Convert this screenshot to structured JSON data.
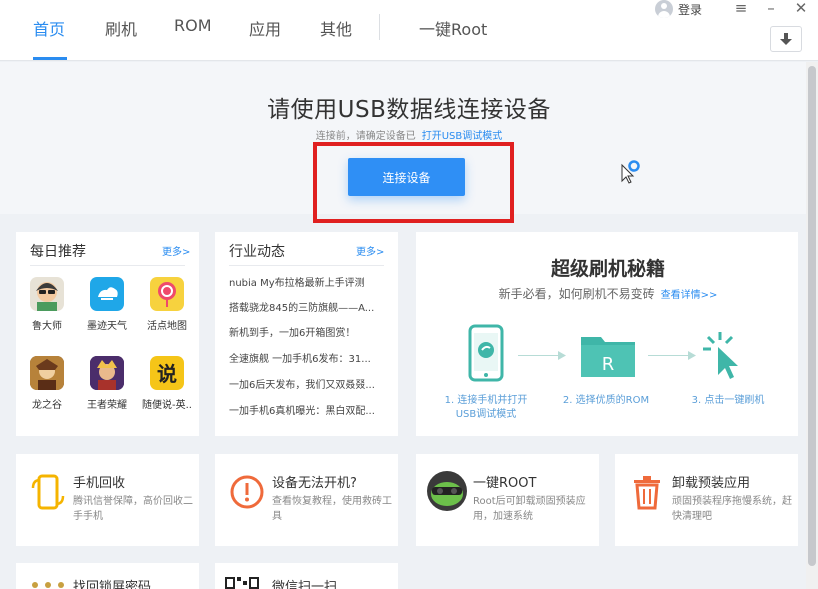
{
  "nav": {
    "tabs": [
      "首页",
      "刷机",
      "ROM",
      "应用",
      "其他",
      "一键Root"
    ],
    "login": "登录"
  },
  "hero": {
    "title": "请使用USB数据线连接设备",
    "subtitle": "连接前，请确定设备已",
    "subtitle_link": "打开USB调试模式",
    "button": "连接设备"
  },
  "daily": {
    "title": "每日推荐",
    "more": "更多>",
    "apps": [
      {
        "name": "鲁大师",
        "icon": "ludashi-icon"
      },
      {
        "name": "墨迹天气",
        "icon": "moji-weather-icon"
      },
      {
        "name": "活点地图",
        "icon": "map-pin-icon"
      },
      {
        "name": "龙之谷",
        "icon": "dragon-nest-icon"
      },
      {
        "name": "王者荣耀",
        "icon": "honor-of-kings-icon"
      },
      {
        "name": "随便说-英...",
        "icon": "shuo-icon"
      }
    ]
  },
  "news": {
    "title": "行业动态",
    "more": "更多>",
    "items": [
      "nubia My布拉格最新上手评测",
      "搭载骁龙845的三防旗舰——A...",
      "新机到手，一加6开箱图赏！",
      "全速旗舰 一加手机6发布：31...",
      "一加6后天发布，我们又双叒叕...",
      "一加手机6真机曝光：黑白双配..."
    ]
  },
  "guide": {
    "title": "超级刷机秘籍",
    "subtitle": "新手必看，如何刷机不易变砖",
    "link": "查看详情>>",
    "steps": [
      {
        "num": "1.",
        "line1": "连接手机并打开",
        "line2": "USB调试模式"
      },
      {
        "num": "2.",
        "line1": "选择优质的ROM",
        "line2": ""
      },
      {
        "num": "3.",
        "line1": "点击一键刷机",
        "line2": ""
      }
    ],
    "rom_letter": "R"
  },
  "services": [
    {
      "title": "手机回收",
      "desc": "腾讯信誉保障，高价回收二手手机",
      "icon": "phone-recycle-icon"
    },
    {
      "title": "设备无法开机?",
      "desc": "查看恢复教程，使用救砖工具",
      "icon": "warning-icon"
    },
    {
      "title": "一键ROOT",
      "desc": "Root后可卸载顽固预装应用，加速系统",
      "icon": "root-icon"
    },
    {
      "title": "卸载预装应用",
      "desc": "顽固预装程序拖慢系统，赶快清理吧",
      "icon": "trash-icon"
    }
  ],
  "partial": [
    "找回锁屏密码",
    "微信扫一扫"
  ],
  "colors": {
    "accent": "#2a8cf0",
    "highlight_box": "#e02020",
    "guide_green": "#3fb6a8"
  }
}
